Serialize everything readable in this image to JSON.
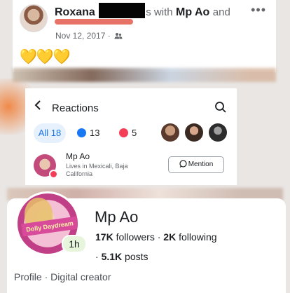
{
  "post": {
    "author": "Roxana",
    "with_text": "s with",
    "tagged_name": "Mp Ao",
    "and_text": "and",
    "date": "Nov 12, 2017 ·",
    "more_label": "•••",
    "emojis": [
      "💛",
      "💛",
      "💛"
    ]
  },
  "reactions": {
    "back_label": "<",
    "title": "Reactions",
    "tabs": {
      "all": "All 18",
      "like_count": "13",
      "love_count": "5"
    },
    "user": {
      "name": "Mp Ao",
      "subtitle": "Lives in Mexicali, Baja California",
      "mention_label": "Mention"
    }
  },
  "profile": {
    "name": "Mp Ao",
    "followers_count": "17K",
    "followers_label": "followers",
    "separator": "·",
    "following_count": "2K",
    "following_label": "following",
    "posts_count": "5.1K",
    "posts_label": "posts",
    "posts_prefix": "·",
    "story_time": "1h",
    "avatar_banner_text": "Dolly Daydream",
    "category": "Profile · Digital creator"
  },
  "colors": {
    "facebook_blue": "#1877f2",
    "love_red": "#f33e58",
    "heart_yellow": "#f5c518"
  }
}
